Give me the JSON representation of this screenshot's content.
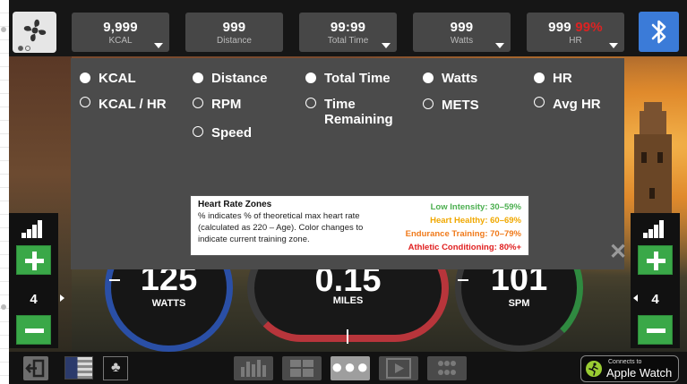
{
  "top_metrics": [
    {
      "value": "9,999",
      "label": "KCAL"
    },
    {
      "value": "999",
      "label": "Distance"
    },
    {
      "value": "99:99",
      "label": "Total Time"
    },
    {
      "value": "999",
      "label": "Watts"
    },
    {
      "value": "999",
      "hr_percent": "99%",
      "label": "HR"
    }
  ],
  "display_options": {
    "kcal": "KCAL",
    "kcal_hr": "KCAL / HR",
    "distance": "Distance",
    "rpm": "RPM",
    "speed": "Speed",
    "total_time": "Total Time",
    "time_remaining_1": "Time",
    "time_remaining_2": "Remaining",
    "watts": "Watts",
    "mets": "METS",
    "hr": "HR",
    "avg_hr": "Avg HR"
  },
  "hr_zones": {
    "title": "Heart Rate Zones",
    "description": "% indicates % of theoretical max heart rate (calculated as 220 – Age).  Color changes to indicate current training zone.",
    "zones": [
      {
        "label": "Low Intensity: 30–59%",
        "color": "#4caf50"
      },
      {
        "label": "Heart Healthy: 60–69%",
        "color": "#f0a800"
      },
      {
        "label": "Endurance Training: 70–79%",
        "color": "#f07a1a"
      },
      {
        "label": "Athletic Conditioning: 80%+",
        "color": "#e02020"
      }
    ],
    "close_symbol": "✕"
  },
  "levels": {
    "left": "4",
    "right": "4"
  },
  "gauges": {
    "watts": {
      "value": "125",
      "label": "WATTS"
    },
    "miles": {
      "value": "0.15",
      "label": "MILES"
    },
    "spm": {
      "value": "101",
      "label": "SPM"
    }
  },
  "apple_watch": {
    "small": "Connects to",
    "big": "Apple Watch"
  },
  "colors": {
    "bluetooth": "#3b7bd8",
    "control_green": "#3aa848",
    "hr_red": "#d22222"
  }
}
